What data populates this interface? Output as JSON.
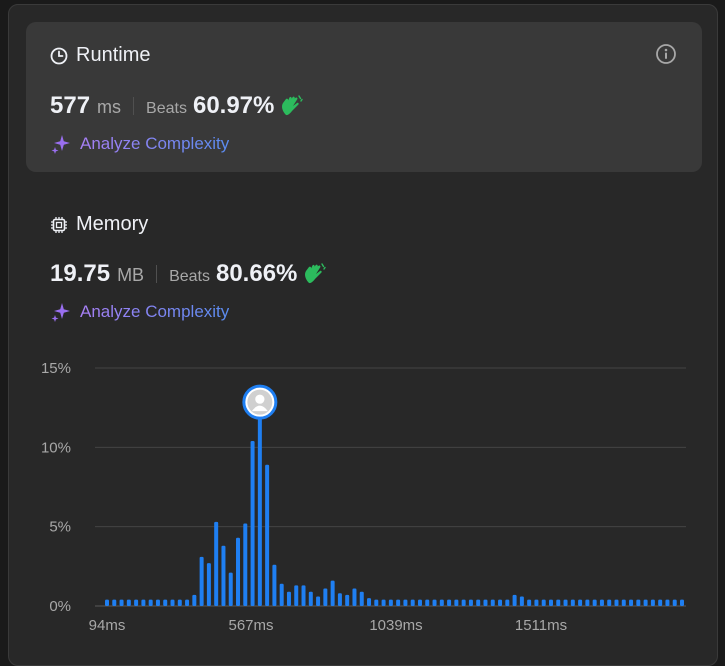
{
  "runtime": {
    "title": "Runtime",
    "value": "577",
    "unit": "ms",
    "beats_label": "Beats",
    "beats_pct": "60.97%",
    "analyze_label": "Analyze Complexity"
  },
  "memory": {
    "title": "Memory",
    "value": "19.75",
    "unit": "MB",
    "beats_label": "Beats",
    "beats_pct": "80.66%",
    "analyze_label": "Analyze Complexity"
  },
  "icons": {
    "runtime": "clock-icon",
    "memory": "chip-icon",
    "info": "info-icon",
    "clap": "clapping-hands-icon",
    "sparkle": "sparkle-icon",
    "avatar": "user-avatar-icon"
  },
  "colors": {
    "bar": "#1f7ff2",
    "clap": "#2cbb5d",
    "sparkle": "#9a6ff0",
    "background": "#282828",
    "card": "#393939"
  },
  "chart_data": {
    "type": "bar",
    "y_unit": "%",
    "ylim": [
      0,
      15
    ],
    "y_ticks": [
      "15%",
      "10%",
      "5%",
      "0%"
    ],
    "x_tick_labels": [
      "94ms",
      "567ms",
      "1039ms",
      "1511ms"
    ],
    "highlighted_index": 21,
    "values": [
      0.4,
      0.4,
      0.4,
      0.4,
      0.4,
      0.4,
      0.4,
      0.4,
      0.4,
      0.4,
      0.4,
      0.4,
      0.7,
      3.1,
      2.7,
      5.3,
      3.8,
      2.1,
      4.3,
      5.2,
      10.4,
      11.9,
      8.9,
      2.6,
      1.4,
      0.9,
      1.3,
      1.3,
      0.9,
      0.6,
      1.1,
      1.6,
      0.8,
      0.7,
      1.1,
      0.9,
      0.5,
      0.4,
      0.4,
      0.4,
      0.4,
      0.4,
      0.4,
      0.4,
      0.4,
      0.4,
      0.4,
      0.4,
      0.4,
      0.4,
      0.4,
      0.4,
      0.4,
      0.4,
      0.4,
      0.4,
      0.7,
      0.6,
      0.4,
      0.4,
      0.4,
      0.4,
      0.4,
      0.4,
      0.4,
      0.4,
      0.4,
      0.4,
      0.4,
      0.4,
      0.4,
      0.4,
      0.4,
      0.4,
      0.4,
      0.4,
      0.4,
      0.4,
      0.4,
      0.4
    ]
  }
}
